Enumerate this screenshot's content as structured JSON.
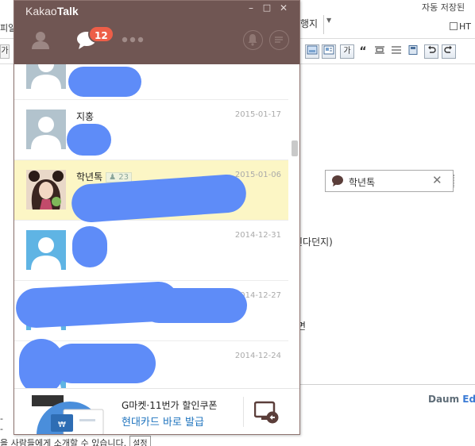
{
  "editor": {
    "autosave_status": "자동 저장된",
    "menu_left": "피일",
    "font_label": "행지",
    "html_label": "HT",
    "cell_label": "가",
    "toolbar": {
      "ga_label": "가",
      "quote_label": "“"
    },
    "quote_box": {
      "label": "학년톡"
    },
    "body_text_1": "친다던지)",
    "body_text_2": "면",
    "daum_label": "Daum",
    "editor_label": "Edi",
    "left_dash_1": "-",
    "left_dash_2": "-",
    "footer_text": "을 사람들에게 소개할 수 있습니다.",
    "footer_button": "설정"
  },
  "kakao": {
    "title_light": "Kakao",
    "title_bold": "Talk",
    "window_controls": {
      "minimize": "–",
      "maximize": "□",
      "close": "✕"
    },
    "tabs": [
      {
        "name": "friends",
        "icon": "person-icon"
      },
      {
        "name": "chats",
        "icon": "chat-bubble-icon",
        "badge": "12"
      },
      {
        "name": "more",
        "icon": "more-dots-icon"
      }
    ],
    "header_buttons": [
      "bell-icon",
      "menu-lines-icon"
    ],
    "chats": [
      {
        "name": "",
        "date": "",
        "avatar": "default-light"
      },
      {
        "name": "지홍",
        "date": "2015-01-17",
        "avatar": "default-light"
      },
      {
        "name": "학년톡",
        "members": "23",
        "date": "2015-01-06",
        "avatar": "photo",
        "selected": true
      },
      {
        "name": "",
        "date": "2014-12-31",
        "avatar": "default-blue"
      },
      {
        "name": "",
        "date": "2014-12-27",
        "avatar": "default-blue"
      },
      {
        "name": "",
        "date": "2014-12-24",
        "avatar": "default-blue"
      }
    ],
    "ad": {
      "line1": "G마켓·11번가 할인쿠폰",
      "line2": "현대카드 바로 발급"
    }
  },
  "colors": {
    "kakao_header": "#705653",
    "badge": "#ed5e48",
    "selected_row": "#fcf6c5",
    "redaction_blue": "#5e8cf8",
    "ad_link": "#1e73be"
  }
}
